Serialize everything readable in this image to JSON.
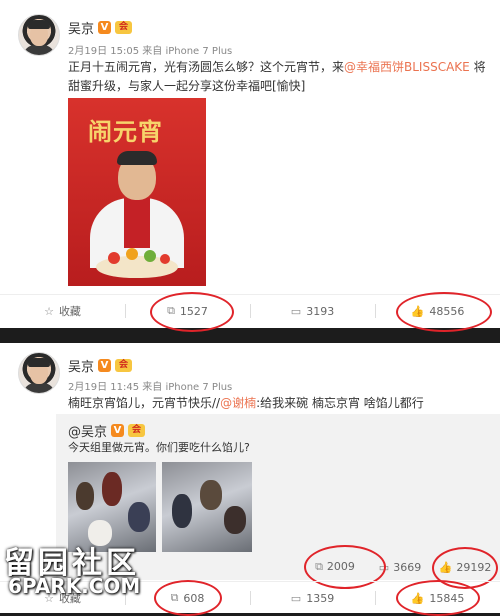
{
  "post1": {
    "author": "吴京",
    "vip_badge": "会",
    "verified_badge": "V",
    "meta": "2月19日 15:05 来自 iPhone 7 Plus",
    "text_a": "正月十五闹元宵，光有汤圆怎么够？这个元宵节，来",
    "mention": "@幸福西饼BLISSCAKE",
    "text_b": " 将甜蜜升级，与家人一起分享这份幸福吧[愉快]",
    "poster_title": "闹元宵",
    "actions": {
      "favorite": "收藏",
      "repost": "1527",
      "comment": "3193",
      "like": "48556"
    }
  },
  "post2": {
    "author": "吴京",
    "vip_badge": "会",
    "verified_badge": "V",
    "meta": "2月19日 11:45 来自 iPhone 7 Plus",
    "text_a": "楠旺京宵馅儿，元宵节快乐//",
    "mention": "@谢楠",
    "text_b": ":给我来碗 楠忘京宵 啥馅儿都行",
    "quoted": {
      "author": "@吴京",
      "verified_badge": "V",
      "vip_badge": "会",
      "text": "今天组里做元宵。你们要吃什么馅儿?",
      "actions": {
        "repost": "2009",
        "comment": "3669",
        "like": "29192"
      }
    },
    "actions": {
      "favorite": "收藏",
      "repost": "608",
      "comment": "1359",
      "like": "15845"
    }
  },
  "watermark": {
    "line1": "留园社区",
    "line2": "6PARK.COM"
  },
  "colors": {
    "link": "#eb7350",
    "highlight_ring": "#e0242a",
    "verified": "#f58a1f"
  }
}
